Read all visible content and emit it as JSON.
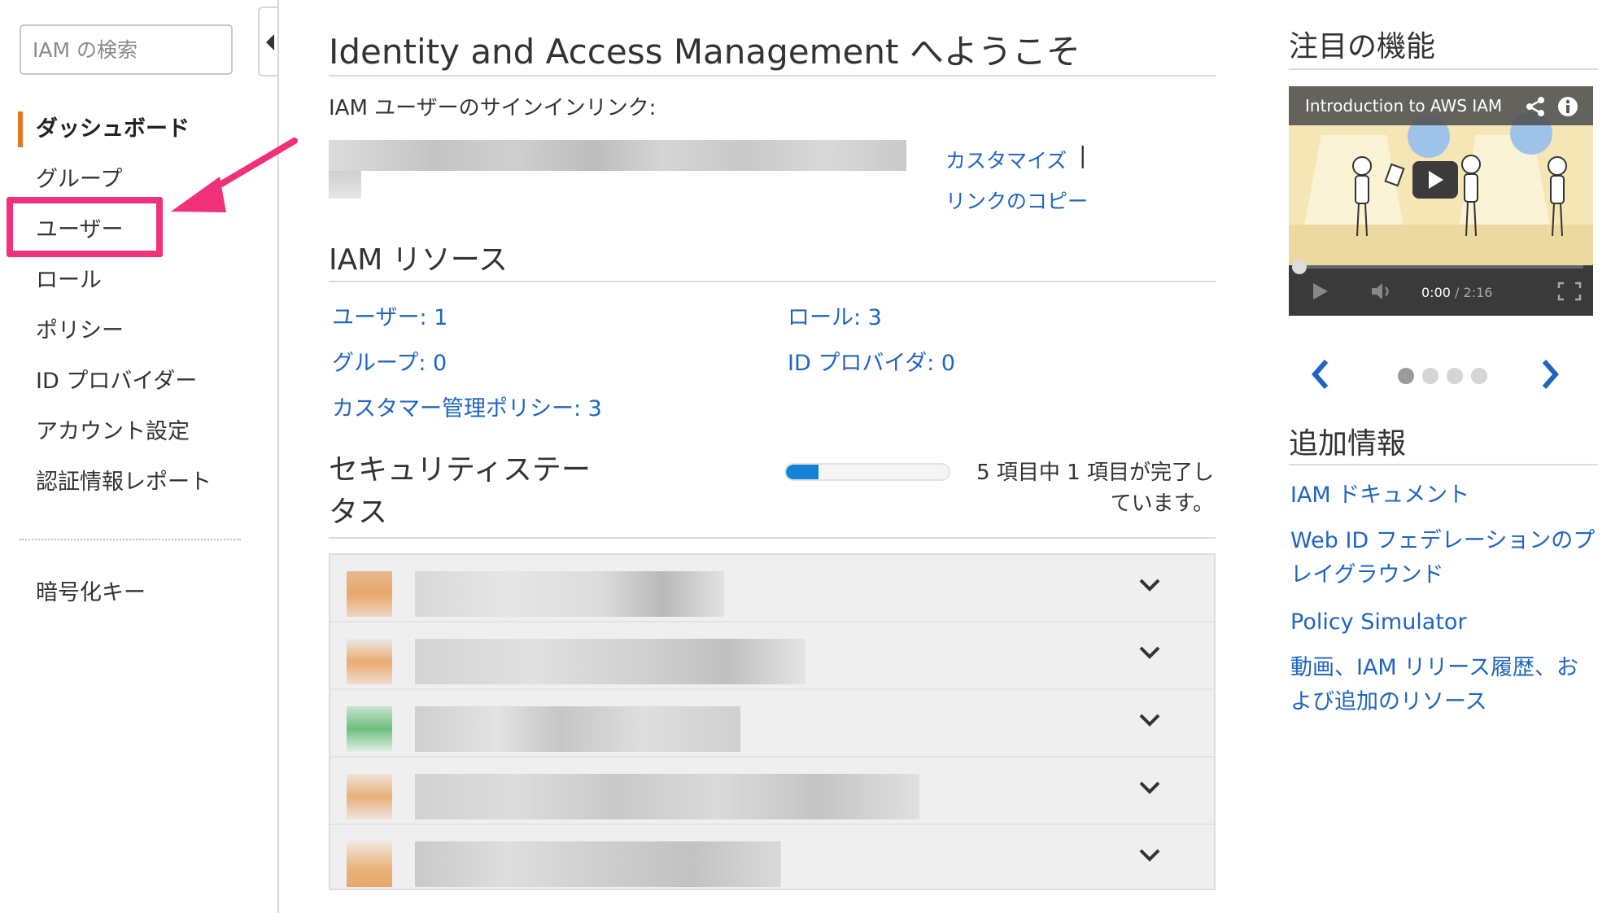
{
  "sidebar": {
    "search_placeholder": "IAM の検索",
    "nav": [
      {
        "label": "ダッシュボード",
        "active": true
      },
      {
        "label": "グループ",
        "active": false
      },
      {
        "label": "ユーザー",
        "active": false,
        "highlighted": true
      },
      {
        "label": "ロール",
        "active": false
      },
      {
        "label": "ポリシー",
        "active": false
      },
      {
        "label": "ID プロバイダー",
        "active": false
      },
      {
        "label": "アカウント設定",
        "active": false
      },
      {
        "label": "認証情報レポート",
        "active": false
      }
    ],
    "secondary_nav": [
      {
        "label": "暗号化キー"
      }
    ],
    "active_accent_color": "#e3771f",
    "annotation_color": "#f0317a"
  },
  "main": {
    "title": "Identity and Access Management へようこそ",
    "signin_label": "IAM ユーザーのサインインリンク:",
    "customize_link": "カスタマイズ",
    "separator": "|",
    "copy_link": "リンクのコピー",
    "resources": {
      "title": "IAM リソース",
      "items": [
        {
          "label": "ユーザー: 1"
        },
        {
          "label": "ロール: 3"
        },
        {
          "label": "グループ: 0"
        },
        {
          "label": "ID プロバイダ: 0"
        },
        {
          "label": "カスタマー管理ポリシー: 3"
        }
      ]
    },
    "security": {
      "title": "セキュリティステータス",
      "progress_completed": 1,
      "progress_total": 5,
      "progress_text": "5 項目中 1 項目が完了しています。",
      "rows": 5
    }
  },
  "right": {
    "featured_title": "注目の機能",
    "video": {
      "title": "Introduction to AWS IAM",
      "current_time": "0:00",
      "duration": "/ 2:16",
      "progress": 0
    },
    "carousel": {
      "total_pages": 4,
      "current_page": 1
    },
    "more_info_title": "追加情報",
    "links": [
      {
        "label": "IAM ドキュメント"
      },
      {
        "label": "Web ID フェデレーションのプレイグラウンド"
      },
      {
        "label": "Policy Simulator"
      },
      {
        "label": "動画、IAM リリース履歴、および追加のリソース"
      }
    ],
    "link_color": "#1f65c0"
  }
}
